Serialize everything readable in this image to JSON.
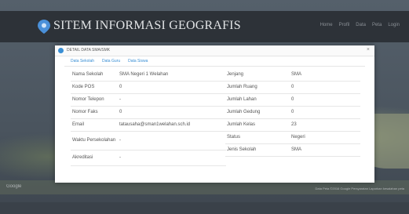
{
  "navbar": {
    "brand": "SITEM INFORMASI GEOGRAFIS",
    "menu": [
      "Home",
      "Profil",
      "Data",
      "Peta",
      "Login"
    ]
  },
  "map": {
    "google": "Google",
    "attribution": "Data Peta ©2016 Google   Persyaratan   Laporkan kesalahan peta"
  },
  "modal": {
    "title": "DETAIL DATA SMA/SMK",
    "close": "×",
    "tabs": [
      "Data Sekolah",
      "Data Guru",
      "Data Siswa"
    ],
    "left_rows": [
      {
        "label": "Nama Sekolah",
        "value": "SMA Negeri 1 Welahan"
      },
      {
        "label": "Kode POS",
        "value": "0"
      },
      {
        "label": "Nomor Telepon",
        "value": "-"
      },
      {
        "label": "Nomor Faks",
        "value": "0"
      },
      {
        "label": "Email",
        "value": "tatausaha@sman1welahan.sch.id"
      },
      {
        "label": "Waktu Persekolahan",
        "value": "-"
      },
      {
        "label": "Akreditasi",
        "value": "-"
      }
    ],
    "right_rows": [
      {
        "label": "Jenjang",
        "value": "SMA"
      },
      {
        "label": "Jumlah Ruang",
        "value": "0"
      },
      {
        "label": "Jumlah Lahan",
        "value": "0"
      },
      {
        "label": "Jumlah Gedung",
        "value": "0"
      },
      {
        "label": "Jumlah Kelas",
        "value": "23"
      },
      {
        "label": "Status",
        "value": "Negeri"
      },
      {
        "label": "Jenis Sekolah",
        "value": "SMA"
      }
    ]
  },
  "colors": {
    "accent": "#3a8fd4",
    "navbar": "#2d3238",
    "map": "#4b5560"
  }
}
